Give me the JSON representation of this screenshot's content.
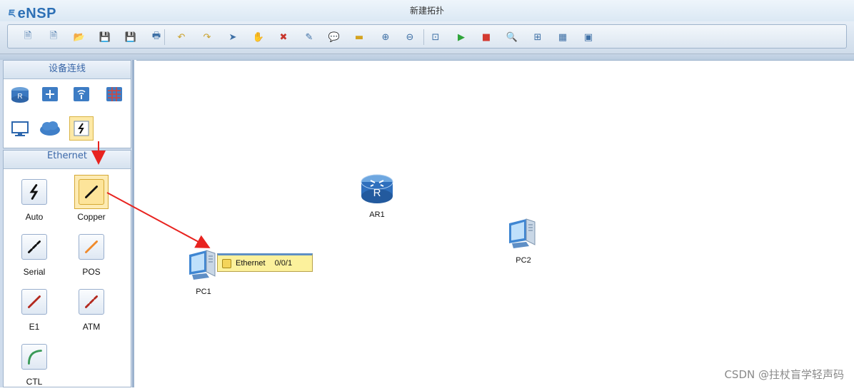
{
  "app": {
    "logo_text": "eNSP",
    "window_title": "新建拓扑"
  },
  "toolbar": {
    "buttons": [
      {
        "name": "new-topology-icon",
        "glyph": "🗎"
      },
      {
        "name": "new-example-icon",
        "glyph": "🗎"
      },
      {
        "name": "open-icon",
        "glyph": "📂"
      },
      {
        "name": "save-icon",
        "glyph": "💾"
      },
      {
        "name": "save-as-icon",
        "glyph": "💾"
      },
      {
        "name": "print-icon",
        "glyph": "🖶"
      },
      {
        "name": "undo-icon",
        "glyph": "↶"
      },
      {
        "name": "redo-icon",
        "glyph": "↷"
      },
      {
        "name": "select-icon",
        "glyph": "➤"
      },
      {
        "name": "pan-hand-icon",
        "glyph": "✋"
      },
      {
        "name": "delete-icon",
        "glyph": "✖"
      },
      {
        "name": "delete-all-links-icon",
        "glyph": "✎"
      },
      {
        "name": "text-annotation-icon",
        "glyph": "💬"
      },
      {
        "name": "draw-rectangle-icon",
        "glyph": "▬"
      },
      {
        "name": "zoom-in-icon",
        "glyph": "⊕"
      },
      {
        "name": "zoom-out-icon",
        "glyph": "⊖"
      },
      {
        "name": "fit-view-icon",
        "glyph": "⊡"
      },
      {
        "name": "start-device-icon",
        "glyph": "▶"
      },
      {
        "name": "stop-device-icon",
        "glyph": "■"
      },
      {
        "name": "capture-icon",
        "glyph": "🔍"
      },
      {
        "name": "topology-icon",
        "glyph": "⊞"
      },
      {
        "name": "grid-icon",
        "glyph": "▦"
      },
      {
        "name": "console-icon",
        "glyph": "▣"
      }
    ]
  },
  "sidebar": {
    "devices_header": "设备连线",
    "cables_header": "Ethernet",
    "cables": [
      {
        "label": "Auto"
      },
      {
        "label": "Copper"
      },
      {
        "label": "Serial"
      },
      {
        "label": "POS"
      },
      {
        "label": "E1"
      },
      {
        "label": "ATM"
      },
      {
        "label": "CTL"
      }
    ]
  },
  "canvas": {
    "nodes": [
      {
        "label": "AR1"
      },
      {
        "label": "PC2"
      },
      {
        "label": "PC1"
      }
    ],
    "tooltip": {
      "port_type": "Ethernet",
      "port_number": "0/0/1"
    }
  },
  "watermark": "CSDN @拄杖盲学轻声码",
  "colors": {
    "accent": "#2c6fb5",
    "arrow": "#e8231f",
    "tooltip_bg": "#fcf19c",
    "selection": "#fde49a"
  }
}
